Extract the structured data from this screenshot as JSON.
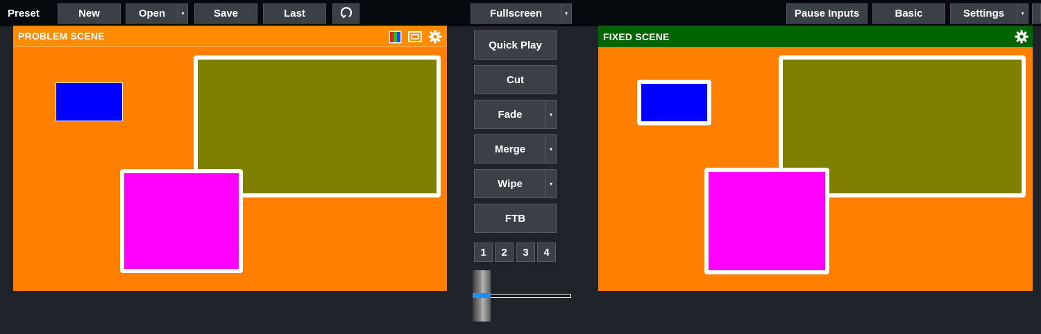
{
  "toolbar": {
    "label": "Preset",
    "new_label": "New",
    "open_label": "Open",
    "save_label": "Save",
    "last_label": "Last",
    "refresh_icon": "refresh-icon",
    "fullscreen_label": "Fullscreen",
    "pause_inputs_label": "Pause Inputs",
    "basic_label": "Basic",
    "settings_label": "Settings",
    "dropdown_icon": "▾"
  },
  "preview": {
    "title": "PROBLEM SCENE",
    "header_color": "#ff8c00",
    "background": "#ff8000",
    "icons": [
      "colors-icon",
      "multiview-icon",
      "gear-icon"
    ],
    "layers": [
      {
        "name": "olive-layer",
        "color": "#808000",
        "border": "#ffffff"
      },
      {
        "name": "blue-layer",
        "color": "#0000ff",
        "border": "#ffffff"
      },
      {
        "name": "magenta-layer",
        "color": "#ff00ff",
        "border": "#ffffff"
      }
    ]
  },
  "output": {
    "title": "FIXED SCENE",
    "header_color": "#006400",
    "background": "#ff8000",
    "icons": [
      "gear-icon"
    ],
    "layers": [
      {
        "name": "olive-layer",
        "color": "#808000",
        "border": "#ffffff"
      },
      {
        "name": "blue-layer",
        "color": "#0000ff",
        "border": "#ffffff"
      },
      {
        "name": "magenta-layer",
        "color": "#ff00ff",
        "border": "#ffffff"
      }
    ]
  },
  "transitions": {
    "quick_play_label": "Quick Play",
    "cut_label": "Cut",
    "fade_label": "Fade",
    "merge_label": "Merge",
    "wipe_label": "Wipe",
    "ftb_label": "FTB",
    "numbers": [
      "1",
      "2",
      "3",
      "4"
    ],
    "tbar_position": 0.0,
    "accent": "#1e90ff"
  }
}
